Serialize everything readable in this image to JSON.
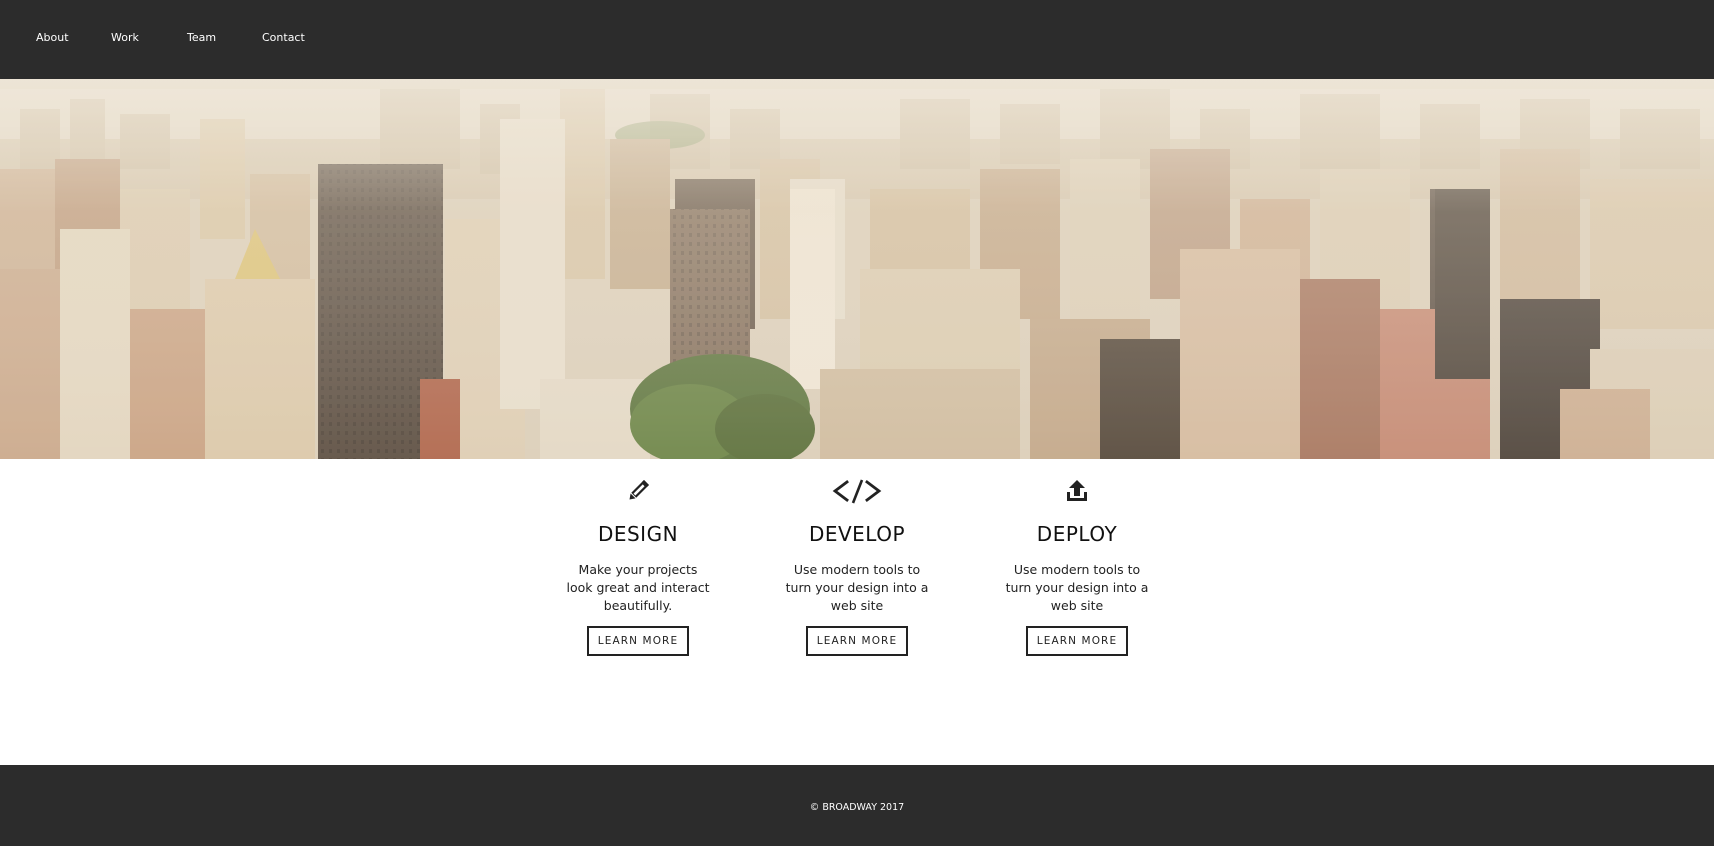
{
  "nav": {
    "items": [
      {
        "label": "About"
      },
      {
        "label": "Work"
      },
      {
        "label": "Team"
      },
      {
        "label": "Contact"
      }
    ]
  },
  "hero": {
    "image": "aerial city skyline"
  },
  "features": [
    {
      "icon": "pencil-icon",
      "title": "DESIGN",
      "description": "Make your projects look great and interact beautifully.",
      "button_label": "LEARN MORE"
    },
    {
      "icon": "code-icon",
      "title": "DEVELOP",
      "description": "Use modern tools to turn your design into a web site",
      "button_label": "LEARN MORE"
    },
    {
      "icon": "upload-icon",
      "title": "DEPLOY",
      "description": "Use modern tools to turn your design into a web site",
      "button_label": "LEARN MORE"
    }
  ],
  "footer": {
    "text": "© BROADWAY 2017"
  },
  "colors": {
    "nav_bg": "#2c2c2c",
    "footer_bg": "#2c2c2c",
    "text": "#222222",
    "nav_text": "#ffffff"
  }
}
